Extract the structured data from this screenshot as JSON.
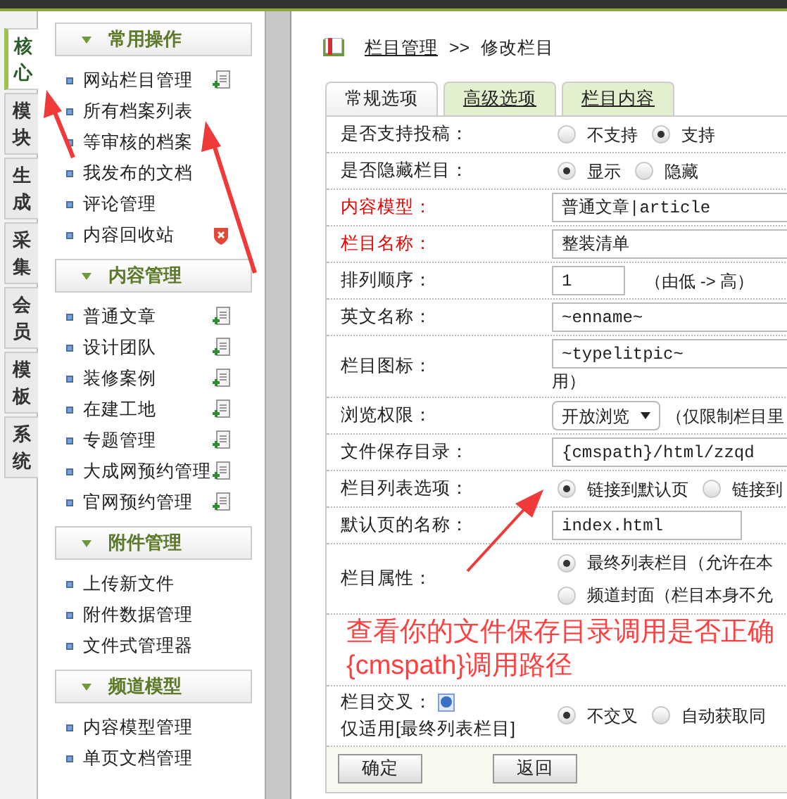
{
  "sidebar_tabs": [
    {
      "label": "核心",
      "selected": true
    },
    {
      "label": "模块",
      "selected": false
    },
    {
      "label": "生成",
      "selected": false
    },
    {
      "label": "采集",
      "selected": false
    },
    {
      "label": "会员",
      "selected": false
    },
    {
      "label": "模板",
      "selected": false
    },
    {
      "label": "系统",
      "selected": false
    }
  ],
  "sidebar_sections": [
    {
      "title": "常用操作",
      "items": [
        {
          "label": "网站栏目管理",
          "kind": "add"
        },
        {
          "label": "所有档案列表",
          "kind": "plain"
        },
        {
          "label": "等审核的档案",
          "kind": "plain"
        },
        {
          "label": "我发布的文档",
          "kind": "plain"
        },
        {
          "label": "评论管理",
          "kind": "plain"
        },
        {
          "label": "内容回收站",
          "kind": "trash"
        }
      ]
    },
    {
      "title": "内容管理",
      "items": [
        {
          "label": "普通文章",
          "kind": "add"
        },
        {
          "label": "设计团队",
          "kind": "add"
        },
        {
          "label": "装修案例",
          "kind": "add"
        },
        {
          "label": "在建工地",
          "kind": "add"
        },
        {
          "label": "专题管理",
          "kind": "add"
        },
        {
          "label": "大成网预约管理",
          "kind": "add"
        },
        {
          "label": "官网预约管理",
          "kind": "add"
        }
      ]
    },
    {
      "title": "附件管理",
      "items": [
        {
          "label": "上传新文件",
          "kind": "plain"
        },
        {
          "label": "附件数据管理",
          "kind": "plain"
        },
        {
          "label": "文件式管理器",
          "kind": "plain"
        }
      ]
    },
    {
      "title": "频道模型",
      "items": [
        {
          "label": "内容模型管理",
          "kind": "plain"
        },
        {
          "label": "单页文档管理",
          "kind": "plain"
        }
      ]
    }
  ],
  "header": {
    "breadcrumb_link": "栏目管理",
    "separator": ">>",
    "title": "修改栏目"
  },
  "tabs": [
    {
      "label": "常规选项",
      "selected": true
    },
    {
      "label": "高级选项",
      "selected": false
    },
    {
      "label": "栏目内容",
      "selected": false
    }
  ],
  "form_rows": [
    {
      "kind": "radio",
      "label": "是否支持投稿：",
      "required": false,
      "options": [
        {
          "label": "不支持",
          "selected": false
        },
        {
          "label": "支持",
          "selected": true
        }
      ]
    },
    {
      "kind": "radio",
      "label": "是否隐藏栏目：",
      "required": false,
      "options": [
        {
          "label": "显示",
          "selected": true
        },
        {
          "label": "隐藏",
          "selected": false
        }
      ]
    },
    {
      "kind": "input",
      "label": "内容模型：",
      "required": true,
      "value": "普通文章|article"
    },
    {
      "kind": "input",
      "label": "栏目名称：",
      "required": true,
      "value": "整装清单"
    },
    {
      "kind": "input_note",
      "label": "排列顺序：",
      "required": false,
      "value": "1",
      "note": "（由低 -> 高）"
    },
    {
      "kind": "input",
      "label": "英文名称：",
      "required": false,
      "value": "~enname~"
    },
    {
      "kind": "input_wrap",
      "label": "栏目图标：",
      "required": false,
      "value": "~typelitpic~",
      "note": "用）"
    },
    {
      "kind": "dropdown",
      "label": "浏览权限：",
      "required": false,
      "value": "开放浏览",
      "note": "（仅限制栏目里"
    },
    {
      "kind": "input",
      "label": "文件保存目录：",
      "required": false,
      "value": "{cmspath}/html/zzqd"
    },
    {
      "kind": "radio",
      "label": "栏目列表选项：",
      "required": false,
      "options": [
        {
          "label": "链接到默认页",
          "selected": true
        },
        {
          "label": "链接到",
          "selected": false
        }
      ]
    },
    {
      "kind": "input_short",
      "label": "默认页的名称：",
      "required": false,
      "value": "index.html"
    },
    {
      "kind": "radio_stack",
      "label": "栏目属性：",
      "required": false,
      "options": [
        {
          "label": "最终列表栏目（允许在本",
          "selected": true
        },
        {
          "label": "频道封面（栏目本身不允",
          "selected": false
        }
      ]
    },
    {
      "kind": "annotation",
      "lines": [
        "查看你的文件保存目录调用是否正确",
        "{cmspath}调用路径"
      ]
    },
    {
      "kind": "radio_help",
      "label": "栏目交叉：",
      "sublabel": "仅适用[最终列表栏目]",
      "required": false,
      "options": [
        {
          "label": "不交叉",
          "selected": true
        },
        {
          "label": "自动获取同",
          "selected": false
        }
      ]
    }
  ],
  "buttons": [
    "确定",
    "返回"
  ]
}
